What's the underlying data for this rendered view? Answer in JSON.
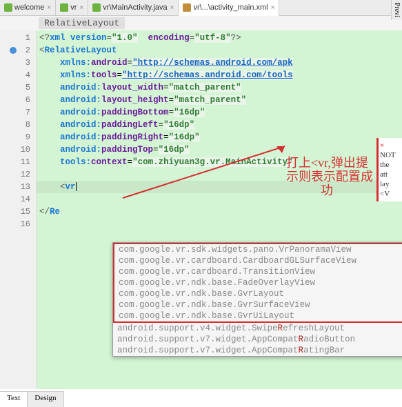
{
  "tabs": [
    {
      "label": "welcome",
      "icon": "java",
      "active": false
    },
    {
      "label": "vr",
      "icon": "java",
      "active": false
    },
    {
      "label": "vr\\MainActivity.java",
      "icon": "java",
      "active": false
    },
    {
      "label": "vr\\...\\activity_main.xml",
      "icon": "xml",
      "active": true
    }
  ],
  "preview_label": "Previ",
  "breadcrumb": "RelativeLayout",
  "line_numbers": [
    "1",
    "2",
    "3",
    "4",
    "5",
    "6",
    "7",
    "8",
    "9",
    "10",
    "11",
    "12",
    "13",
    "14",
    "15",
    "16"
  ],
  "code": {
    "l1_pre": "<?",
    "l1_tag": "xml version",
    "l1_eq1": "=",
    "l1_v1": "\"1.0\"",
    "l1_sp": "  ",
    "l1_enc": "encoding",
    "l1_eq2": "=",
    "l1_v2": "\"utf-8\"",
    "l1_end": "?>",
    "l2": "<",
    "l2_tag": "RelativeLayout",
    "l3_ns": "xmlns:",
    "l3_a": "android",
    "l3_eq": "=",
    "l3_v": "\"http://schemas.android.com/apk",
    "l4_ns": "xmlns:",
    "l4_a": "tools",
    "l4_eq": "=",
    "l4_v": "\"http://schemas.android.com/tools",
    "l5_ns": "android:",
    "l5_a": "layout_width",
    "l5_eq": "=",
    "l5_v": "\"match_parent\"",
    "l6_ns": "android:",
    "l6_a": "layout_height",
    "l6_eq": "=",
    "l6_v": "\"match_parent\"",
    "l7_ns": "android:",
    "l7_a": "paddingBottom",
    "l7_eq": "=",
    "l7_v": "\"16dp\"",
    "l8_ns": "android:",
    "l8_a": "paddingLeft",
    "l8_eq": "=",
    "l8_v": "\"16dp\"",
    "l9_ns": "android:",
    "l9_a": "paddingRight",
    "l9_eq": "=",
    "l9_v": "\"16dp\"",
    "l10_ns": "android:",
    "l10_a": "paddingTop",
    "l10_eq": "=",
    "l10_v": "\"16dp\"",
    "l11_ns": "tools:",
    "l11_a": "context",
    "l11_eq": "=",
    "l11_v": "\"com.zhiyuan3g.vr.MainActivity\"",
    "l13": "<",
    "l13_tag": "vr",
    "l15": "</",
    "l15_tag": "Re"
  },
  "annotation": {
    "line1": "打上<vr,弹出提",
    "line2": "示则表示配置成",
    "line3": "功"
  },
  "autocomplete": {
    "vr_items": [
      "com.google.vr.sdk.widgets.pano.VrPanoramaView",
      "com.google.vr.cardboard.CardboardGLSurfaceView",
      "com.google.vr.cardboard.TransitionView",
      "com.google.vr.ndk.base.FadeOverlayView",
      "com.google.vr.ndk.base.GvrLayout",
      "com.google.vr.ndk.base.GvrSurfaceView",
      "com.google.vr.ndk.base.GvrUiLayout"
    ],
    "other_items": [
      {
        "pre": "android.support.v4.widget.Swipe",
        "hl": "R",
        "post": "efreshLayout"
      },
      {
        "pre": "android.support.v7.widget.AppCompat",
        "hl": "R",
        "post": "adioButton"
      },
      {
        "pre": "android.support.v7.widget.AppCompat",
        "hl": "R",
        "post": "atingBar"
      }
    ]
  },
  "side_panel": [
    "×",
    "NOT",
    "the",
    "att",
    "lay",
    "<V"
  ],
  "bottom_tabs": [
    {
      "label": "Text",
      "active": true
    },
    {
      "label": "Design",
      "active": false
    }
  ]
}
